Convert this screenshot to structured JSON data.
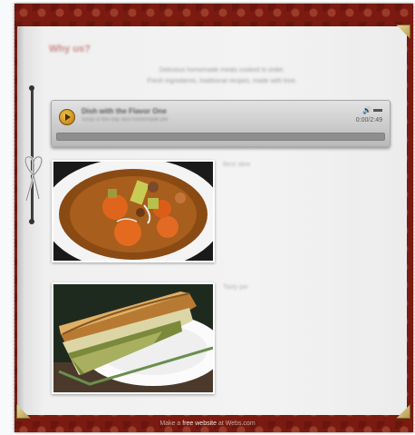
{
  "page": {
    "title": "Why us?",
    "intro_line1": "Delicious homemade meals cooked to order.",
    "intro_line2": "Fresh ingredients, traditional recipes, made with love."
  },
  "player": {
    "track_title": "Dish with the Flavor One",
    "track_subtitle": "Soup of the day and homemade pie",
    "time": "0:00/2:49"
  },
  "gallery": [
    {
      "caption": "Best stew"
    },
    {
      "caption": "Tasty pie"
    }
  ],
  "footer": {
    "prefix": "Make a ",
    "brand": "free website",
    "suffix": " at Webs.com"
  },
  "colors": {
    "border_red": "#7a1a10",
    "page": "#f1f1f1",
    "play_gold": "#d9a228"
  }
}
